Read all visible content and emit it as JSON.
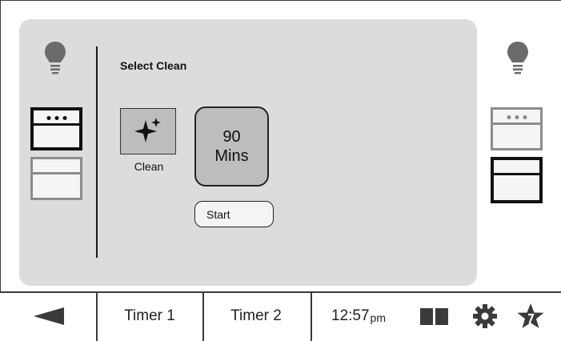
{
  "panel": {
    "title": "Select Clean",
    "clean_option": {
      "label": "Clean",
      "icon": "sparkle-icon"
    },
    "duration": {
      "value": "90",
      "unit": "Mins"
    },
    "start_label": "Start"
  },
  "left_controls": {
    "light_icon": "lightbulb-icon",
    "ovens": [
      "upper-oven-icon",
      "lower-oven-icon"
    ],
    "selected": "upper"
  },
  "right_controls": {
    "light_icon": "lightbulb-icon",
    "ovens": [
      "upper-oven-icon",
      "lower-oven-icon"
    ],
    "selected": "lower"
  },
  "bottom_bar": {
    "back_icon": "back-arrow-icon",
    "timer1_label": "Timer 1",
    "timer2_label": "Timer 2",
    "time": "12:57",
    "ampm": "pm",
    "icons": [
      "dual-panel-icon",
      "gear-icon",
      "favorite-star-icon"
    ]
  },
  "colors": {
    "panel_bg": "#dcdcdc",
    "button_fill": "#bdbdbd",
    "selected_outline": "#111111",
    "unselected_outline": "#8c8c8c"
  }
}
